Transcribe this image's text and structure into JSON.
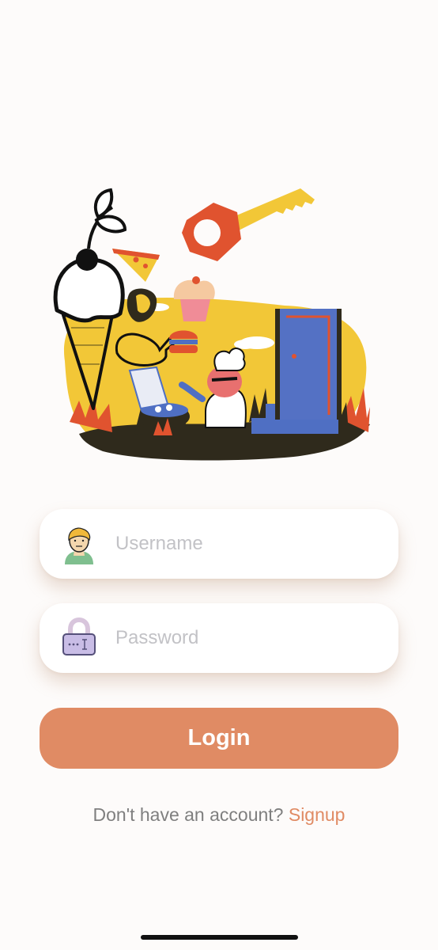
{
  "login_form": {
    "username": {
      "placeholder": "Username",
      "value": "",
      "icon": "user-avatar-icon"
    },
    "password": {
      "placeholder": "Password",
      "value": "",
      "icon": "padlock-icon"
    },
    "login_label": "Login"
  },
  "signup": {
    "prompt": "Don't have an account?",
    "link_label": "Signup"
  },
  "colors": {
    "accent": "#e08b64",
    "background": "#fdfbfa",
    "placeholder": "#c2c2c6",
    "muted_text": "#7f7f7f"
  }
}
